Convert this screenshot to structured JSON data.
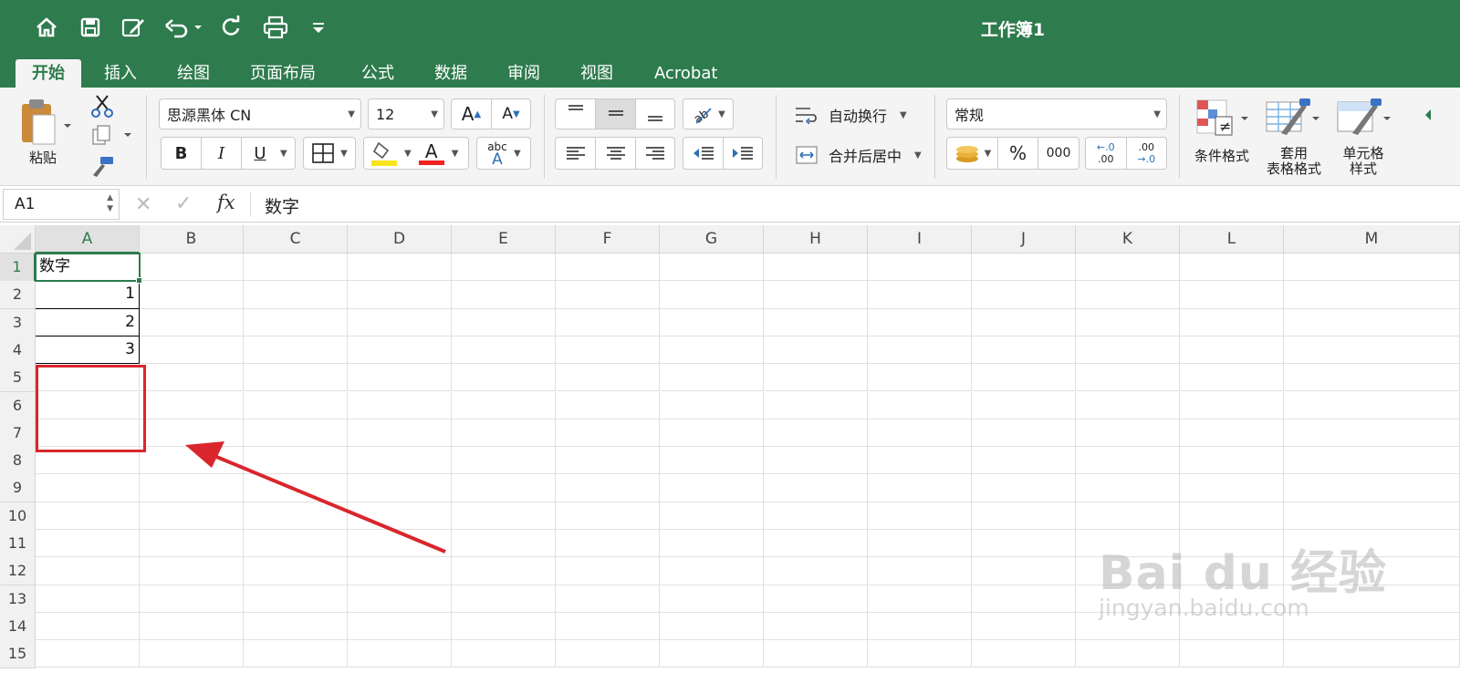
{
  "window": {
    "title": "工作簿1"
  },
  "quick_access": {
    "icons": [
      "home-icon",
      "save-icon",
      "edit-icon",
      "undo-icon",
      "redo-icon",
      "print-icon",
      "customize-icon"
    ]
  },
  "tabs": [
    {
      "label": "开始",
      "active": true
    },
    {
      "label": "插入"
    },
    {
      "label": "绘图"
    },
    {
      "label": "页面布局"
    },
    {
      "label": "公式"
    },
    {
      "label": "数据"
    },
    {
      "label": "审阅"
    },
    {
      "label": "视图"
    },
    {
      "label": "Acrobat"
    }
  ],
  "ribbon": {
    "paste_label": "粘贴",
    "font_name": "思源黑体 CN",
    "font_size": "12",
    "grow_font": "A",
    "shrink_font": "A",
    "bold": "B",
    "italic": "I",
    "underline": "U",
    "font_color_glyph": "A",
    "phonetic_top": "abc",
    "phonetic_bottom": "A",
    "wrap_text": "自动换行",
    "merge_center": "合并后居中",
    "number_format": "常规",
    "percent": "%",
    "comma": "000",
    "increase_decimal_top": "←.0",
    "increase_decimal_bottom": ".00",
    "decrease_decimal_top": ".00",
    "decrease_decimal_bottom": "→.0",
    "conditional_format": "条件格式",
    "table_format_line1": "套用",
    "table_format_line2": "表格格式",
    "cell_styles_line1": "单元格",
    "cell_styles_line2": "样式"
  },
  "formula_bar": {
    "name_box": "A1",
    "cancel": "✕",
    "confirm": "✓",
    "fx": "fx",
    "content": "数字"
  },
  "grid": {
    "columns": [
      "A",
      "B",
      "C",
      "D",
      "E",
      "F",
      "G",
      "H",
      "I",
      "J",
      "K",
      "L",
      "M"
    ],
    "rows": [
      "1",
      "2",
      "3",
      "4",
      "5",
      "6",
      "7",
      "8",
      "9",
      "10",
      "11",
      "12",
      "13",
      "14",
      "15"
    ],
    "cells": {
      "A1": "数字",
      "A2": "1",
      "A3": "2",
      "A4": "3"
    }
  },
  "watermark": {
    "brand": "Bai du 经验",
    "url": "jingyan.baidu.com"
  },
  "colors": {
    "accent": "#2e7b4d",
    "annotation": "#d9262c"
  }
}
